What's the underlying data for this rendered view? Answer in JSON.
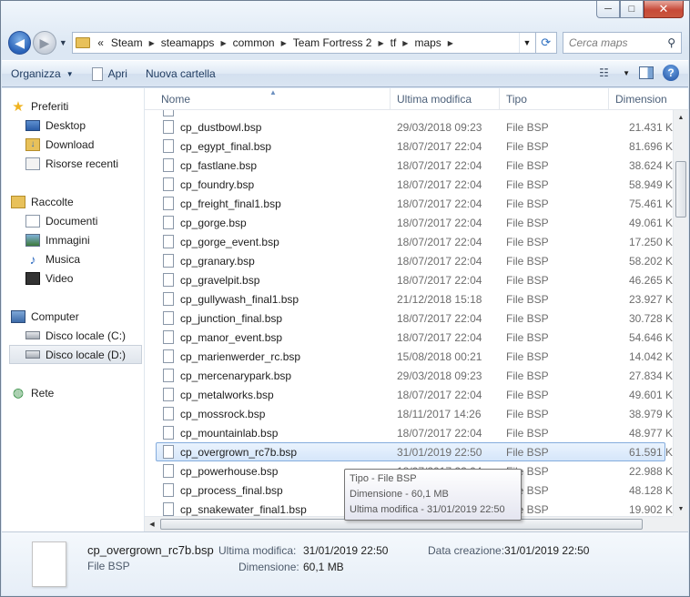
{
  "window": {
    "min": "─",
    "max": "□",
    "close": "✕"
  },
  "address": {
    "overflow": "«",
    "crumbs": [
      "Steam",
      "steamapps",
      "common",
      "Team Fortress 2",
      "tf",
      "maps"
    ]
  },
  "search": {
    "placeholder": "Cerca maps"
  },
  "toolbar": {
    "organize": "Organizza",
    "open": "Apri",
    "new_folder": "Nuova cartella",
    "help": "?"
  },
  "nav": {
    "favorites": "Preferiti",
    "desktop": "Desktop",
    "download": "Download",
    "recent": "Risorse recenti",
    "libraries": "Raccolte",
    "documents": "Documenti",
    "images": "Immagini",
    "music": "Musica",
    "video": "Video",
    "computer": "Computer",
    "disk_c": "Disco locale (C:)",
    "disk_d": "Disco locale (D:)",
    "network": "Rete"
  },
  "columns": {
    "name": "Nome",
    "modified": "Ultima modifica",
    "type": "Tipo",
    "size": "Dimension"
  },
  "files": [
    {
      "name": "cp_dustbowl.bsp",
      "date": "29/03/2018 09:23",
      "type": "File BSP",
      "size": "21.431 K"
    },
    {
      "name": "cp_egypt_final.bsp",
      "date": "18/07/2017 22:04",
      "type": "File BSP",
      "size": "81.696 K"
    },
    {
      "name": "cp_fastlane.bsp",
      "date": "18/07/2017 22:04",
      "type": "File BSP",
      "size": "38.624 K"
    },
    {
      "name": "cp_foundry.bsp",
      "date": "18/07/2017 22:04",
      "type": "File BSP",
      "size": "58.949 K"
    },
    {
      "name": "cp_freight_final1.bsp",
      "date": "18/07/2017 22:04",
      "type": "File BSP",
      "size": "75.461 K"
    },
    {
      "name": "cp_gorge.bsp",
      "date": "18/07/2017 22:04",
      "type": "File BSP",
      "size": "49.061 K"
    },
    {
      "name": "cp_gorge_event.bsp",
      "date": "18/07/2017 22:04",
      "type": "File BSP",
      "size": "17.250 K"
    },
    {
      "name": "cp_granary.bsp",
      "date": "18/07/2017 22:04",
      "type": "File BSP",
      "size": "58.202 K"
    },
    {
      "name": "cp_gravelpit.bsp",
      "date": "18/07/2017 22:04",
      "type": "File BSP",
      "size": "46.265 K"
    },
    {
      "name": "cp_gullywash_final1.bsp",
      "date": "21/12/2018 15:18",
      "type": "File BSP",
      "size": "23.927 K"
    },
    {
      "name": "cp_junction_final.bsp",
      "date": "18/07/2017 22:04",
      "type": "File BSP",
      "size": "30.728 K"
    },
    {
      "name": "cp_manor_event.bsp",
      "date": "18/07/2017 22:04",
      "type": "File BSP",
      "size": "54.646 K"
    },
    {
      "name": "cp_marienwerder_rc.bsp",
      "date": "15/08/2018 00:21",
      "type": "File BSP",
      "size": "14.042 K"
    },
    {
      "name": "cp_mercenarypark.bsp",
      "date": "29/03/2018 09:23",
      "type": "File BSP",
      "size": "27.834 K"
    },
    {
      "name": "cp_metalworks.bsp",
      "date": "18/07/2017 22:04",
      "type": "File BSP",
      "size": "49.601 K"
    },
    {
      "name": "cp_mossrock.bsp",
      "date": "18/11/2017 14:26",
      "type": "File BSP",
      "size": "38.979 K"
    },
    {
      "name": "cp_mountainlab.bsp",
      "date": "18/07/2017 22:04",
      "type": "File BSP",
      "size": "48.977 K"
    },
    {
      "name": "cp_overgrown_rc7b.bsp",
      "date": "31/01/2019 22:50",
      "type": "File BSP",
      "size": "61.591 K"
    },
    {
      "name": "cp_powerhouse.bsp",
      "date": "18/07/2017 22:04",
      "type": "File BSP",
      "size": "22.988 K"
    },
    {
      "name": "cp_process_final.bsp",
      "date": "18/07/2017 22:04",
      "type": "File BSP",
      "size": "48.128 K"
    },
    {
      "name": "cp_snakewater_final1.bsp",
      "date": "18/07/2017 22:04",
      "type": "File BSP",
      "size": "19.902 K"
    }
  ],
  "tooltip": {
    "type": "Tipo - File BSP",
    "size": "Dimensione - 60,1 MB",
    "modified": "Ultima modifica - 31/01/2019 22:50"
  },
  "details": {
    "name": "cp_overgrown_rc7b.bsp",
    "type": "File BSP",
    "modified_label": "Ultima modifica:",
    "modified_value": "31/01/2019 22:50",
    "created_label": "Data creazione:",
    "created_value": "31/01/2019 22:50",
    "size_label": "Dimensione:",
    "size_value": "60,1 MB"
  }
}
